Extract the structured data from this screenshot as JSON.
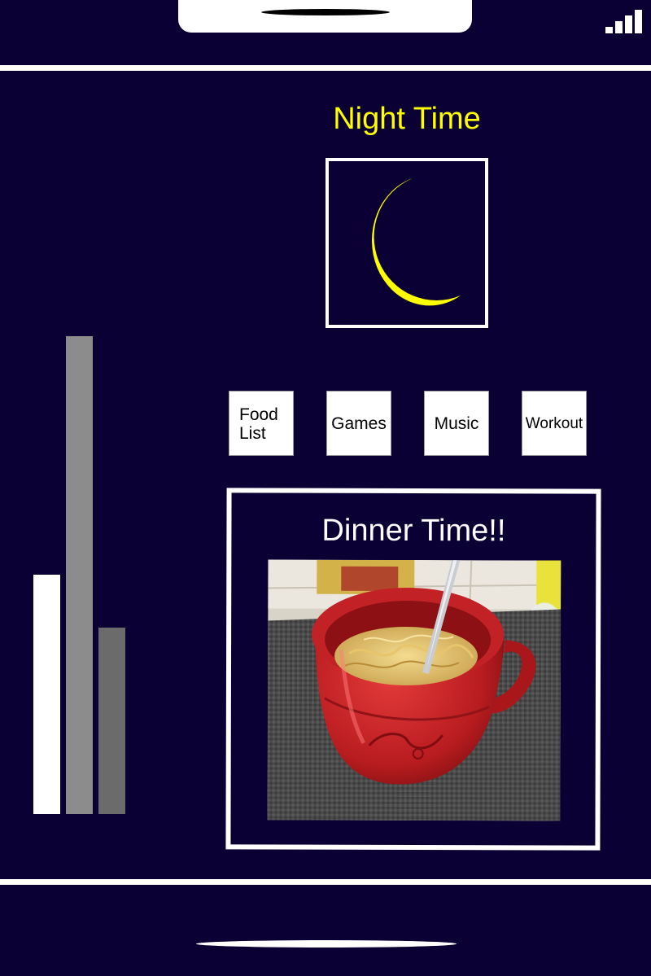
{
  "theme": {
    "background": "#0a0033",
    "accent": "#ffff00",
    "foreground": "#ffffff"
  },
  "status_bar": {
    "signal_icon": "signal-bars-icon"
  },
  "header": {
    "title": "Night Time",
    "mode_icon": "crescent-moon-icon"
  },
  "level_meter": {
    "levels": [
      0.5,
      1.0,
      0.39
    ],
    "colors": [
      "#ffffff",
      "#8c8c8c",
      "#6b6b6b"
    ]
  },
  "nav": {
    "food_list": "Food\nList",
    "games": "Games",
    "music": "Music",
    "workout": "Workout"
  },
  "dinner_card": {
    "title": "Dinner Time!!",
    "image": "red-mug-of-ramen-noodles-photo"
  },
  "home_indicator": "home-indicator-bar"
}
